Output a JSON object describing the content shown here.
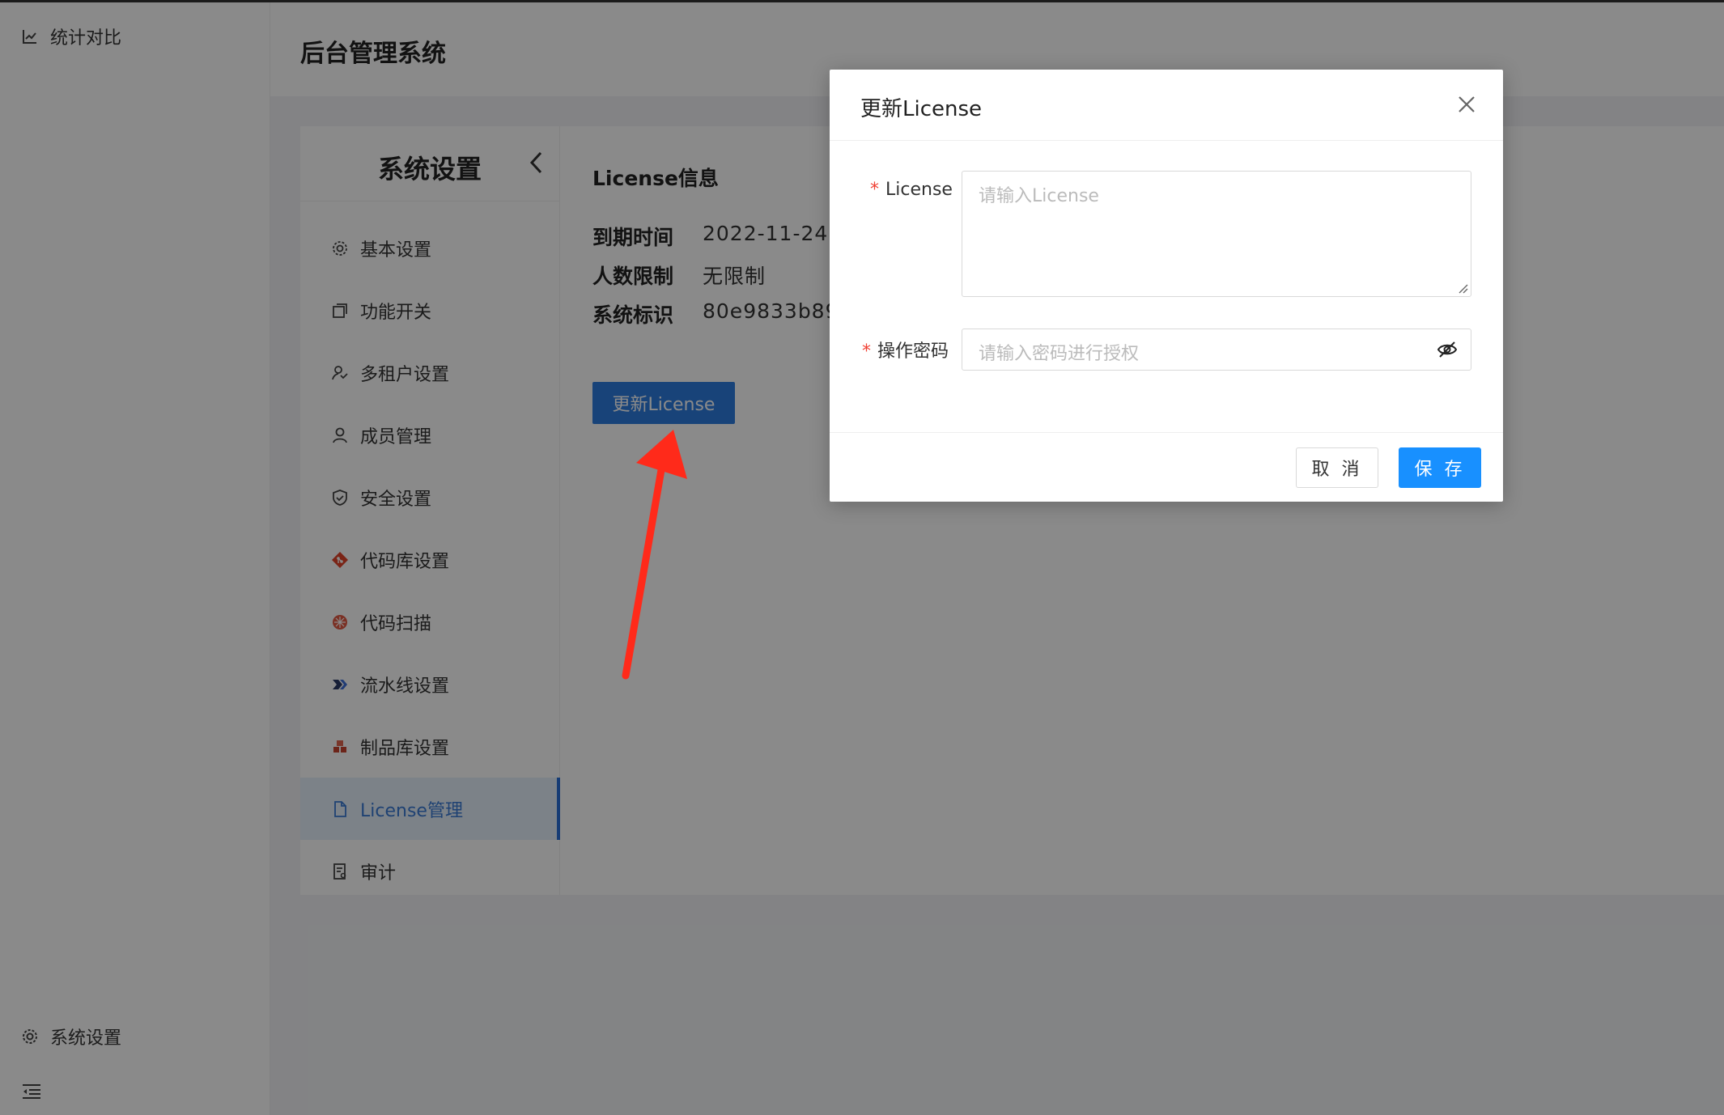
{
  "app": {
    "title": "后台管理系统"
  },
  "outer_sidebar": {
    "top_item": "统计对比",
    "bottom_item": "系统设置"
  },
  "settings": {
    "title": "系统设置",
    "menu": [
      {
        "label": "基本设置",
        "icon": "gear-icon"
      },
      {
        "label": "功能开关",
        "icon": "toggle-icon"
      },
      {
        "label": "多租户设置",
        "icon": "tenant-icon"
      },
      {
        "label": "成员管理",
        "icon": "user-icon"
      },
      {
        "label": "安全设置",
        "icon": "shield-icon"
      },
      {
        "label": "代码库设置",
        "icon": "git-icon"
      },
      {
        "label": "代码扫描",
        "icon": "scan-icon"
      },
      {
        "label": "流水线设置",
        "icon": "pipeline-icon"
      },
      {
        "label": "制品库设置",
        "icon": "artifact-icon"
      },
      {
        "label": "License管理",
        "icon": "file-icon",
        "active": true
      },
      {
        "label": "审计",
        "icon": "audit-icon"
      }
    ]
  },
  "license_info": {
    "title": "License信息",
    "rows": [
      {
        "key": "到期时间",
        "value": "2022-11-24"
      },
      {
        "key": "人数限制",
        "value": "无限制"
      },
      {
        "key": "系统标识",
        "value": "80e9833b89"
      }
    ],
    "update_button": "更新License"
  },
  "modal": {
    "title": "更新License",
    "license_label": "License",
    "license_placeholder": "请输入License",
    "password_label": "操作密码",
    "password_placeholder": "请输入密码进行授权",
    "cancel": "取 消",
    "save": "保 存",
    "required_mark": "*"
  },
  "colors": {
    "primary": "#1890ff",
    "active_menu": "#3a7bd5",
    "required": "#f04134",
    "arrow": "#ff2a1a"
  }
}
